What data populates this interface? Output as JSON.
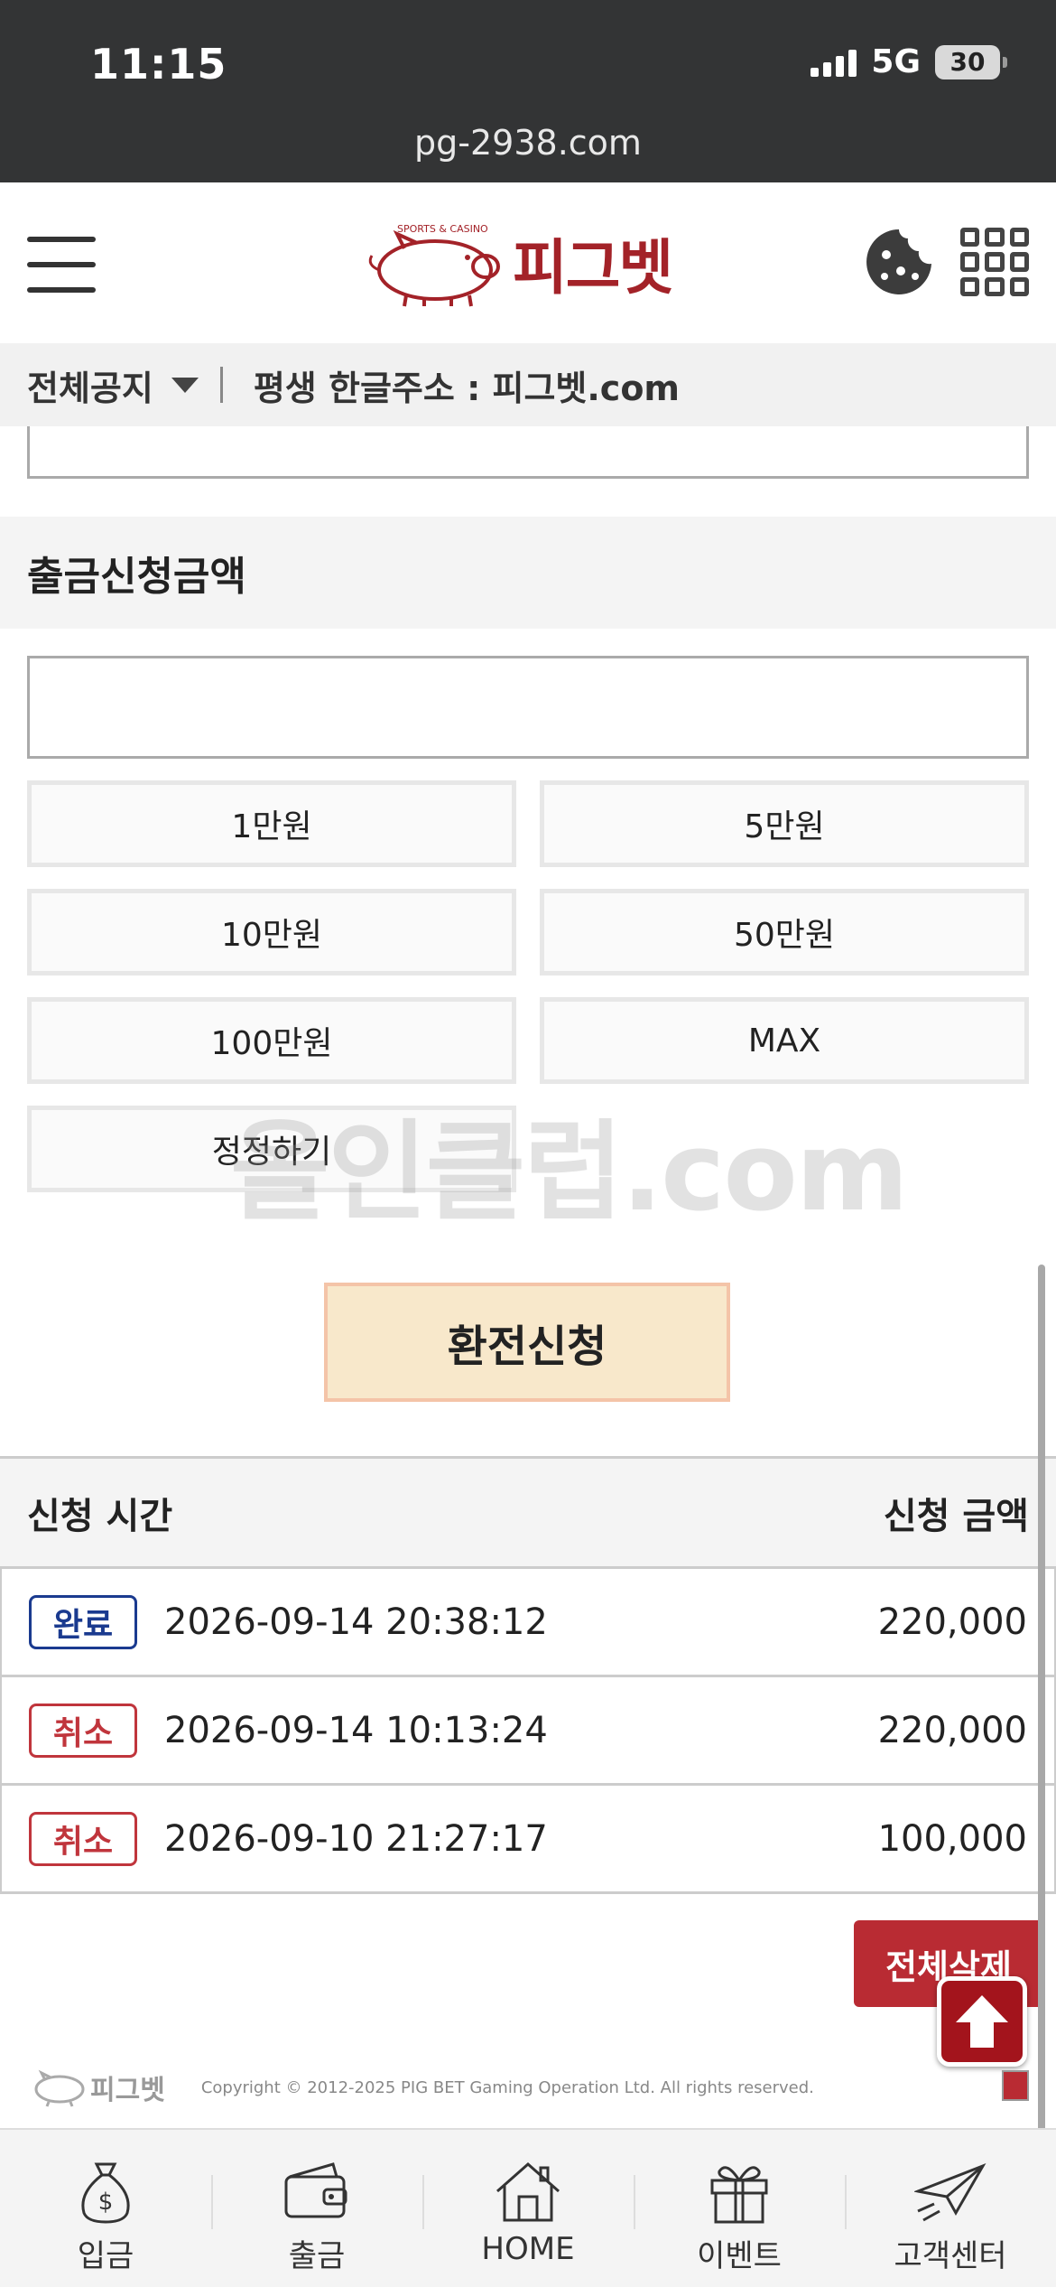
{
  "status_bar": {
    "time": "11:15",
    "network": "5G",
    "battery": "30"
  },
  "url": "pg-2938.com",
  "header": {
    "logo_text": "피그벳",
    "logo_small_text": "SPORTS & CASINO"
  },
  "notice": {
    "category": "전체공지",
    "text": "평생 한글주소 : 피그벳.com"
  },
  "withdraw": {
    "section_title": "출금신청금액",
    "amount_value": "",
    "amount_buttons": [
      "1만원",
      "5만원",
      "10만원",
      "50만원",
      "100만원",
      "MAX",
      "정정하기"
    ],
    "submit_label": "환전신청"
  },
  "watermark": "올인클럽.com",
  "history": {
    "col_time": "신청 시간",
    "col_amount": "신청 금액",
    "rows": [
      {
        "status": "완료",
        "time": "2026-09-14 20:38:12",
        "amount": "220,000"
      },
      {
        "status": "취소",
        "time": "2026-09-14 10:13:24",
        "amount": "220,000"
      },
      {
        "status": "취소",
        "time": "2026-09-10 21:27:17",
        "amount": "100,000"
      }
    ],
    "delete_all_label": "전체삭제"
  },
  "footer": {
    "logo_text": "피그벳",
    "copyright": "Copyright © 2012-2025 PIG BET Gaming Operation Ltd. All rights reserved."
  },
  "bottom_nav": [
    {
      "label": "입금",
      "icon": "money-bag-icon"
    },
    {
      "label": "출금",
      "icon": "wallet-icon"
    },
    {
      "label": "HOME",
      "icon": "home-icon"
    },
    {
      "label": "이벤트",
      "icon": "gift-icon"
    },
    {
      "label": "고객센터",
      "icon": "paper-plane-icon"
    }
  ],
  "colors": {
    "brand_red": "#a32228",
    "status_complete": "#1a3a8f",
    "status_cancel": "#c0353c",
    "submit_bg": "#f8e8cb",
    "status_bar_bg": "#333435"
  }
}
